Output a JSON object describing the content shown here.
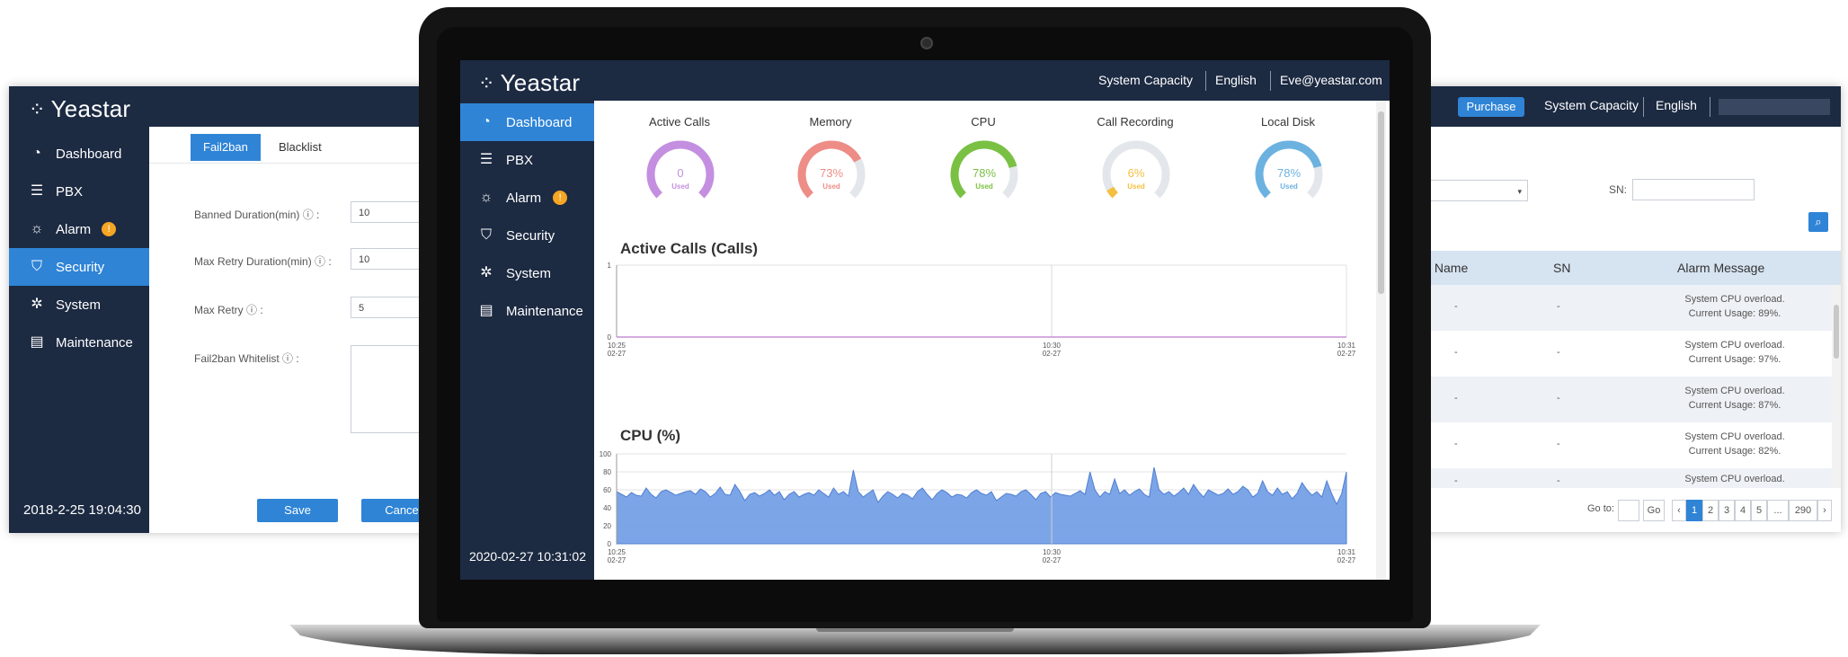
{
  "brand": {
    "name": "Yeastar"
  },
  "left_panel": {
    "sidebar": {
      "items": [
        {
          "label": "Dashboard",
          "icon": "dashboard-icon"
        },
        {
          "label": "PBX",
          "icon": "pbx-icon"
        },
        {
          "label": "Alarm",
          "icon": "alarm-icon",
          "badge": "!"
        },
        {
          "label": "Security",
          "icon": "shield-icon"
        },
        {
          "label": "System",
          "icon": "gear-icon"
        },
        {
          "label": "Maintenance",
          "icon": "maintenance-icon"
        }
      ],
      "active": "Security",
      "timestamp": "2018-2-25 19:04:30"
    },
    "tabs": [
      "Fail2ban",
      "Blacklist"
    ],
    "active_tab": "Fail2ban",
    "form": {
      "banned_duration": {
        "label": "Banned Duration(min) ⓘ :",
        "value": "10"
      },
      "max_retry_duration": {
        "label": "Max Retry Duration(min) ⓘ :",
        "value": "10"
      },
      "max_retry": {
        "label": "Max Retry ⓘ :",
        "value": "5"
      },
      "whitelist": {
        "label": "Fail2ban Whitelist ⓘ :",
        "value": ""
      }
    },
    "buttons": {
      "save": "Save",
      "cancel": "Cance"
    }
  },
  "right_panel": {
    "topbar": {
      "purchase": "Purchase",
      "capacity": "System Capacity",
      "language": "English"
    },
    "sn_label": "SN:",
    "table": {
      "columns": [
        "PBX Name",
        "SN",
        "Alarm Message"
      ],
      "rows": [
        {
          "pbx": "-",
          "sn": "-",
          "msg1": "System CPU overload.",
          "msg2": "Current Usage: 89%."
        },
        {
          "pbx": "-",
          "sn": "-",
          "msg1": "System CPU overload.",
          "msg2": "Current Usage: 97%."
        },
        {
          "pbx": "-",
          "sn": "-",
          "msg1": "System CPU overload.",
          "msg2": "Current Usage: 87%."
        },
        {
          "pbx": "-",
          "sn": "-",
          "msg1": "System CPU overload.",
          "msg2": "Current Usage: 82%."
        },
        {
          "pbx": "-",
          "sn": "-",
          "msg1": "System CPU overload.",
          "msg2": ""
        }
      ]
    },
    "pagination": {
      "goto_label": "Go to:",
      "go": "Go",
      "pages": [
        "1",
        "2",
        "3",
        "4",
        "5"
      ],
      "ellipsis": "...",
      "last": "290",
      "current": "1"
    }
  },
  "screen": {
    "topbar": {
      "capacity": "System Capacity",
      "language": "English",
      "user": "Eve@yeastar.com"
    },
    "sidebar": {
      "items": [
        {
          "label": "Dashboard",
          "icon": "dashboard-icon"
        },
        {
          "label": "PBX",
          "icon": "pbx-icon"
        },
        {
          "label": "Alarm",
          "icon": "alarm-icon",
          "badge": "!"
        },
        {
          "label": "Security",
          "icon": "shield-icon"
        },
        {
          "label": "System",
          "icon": "gear-icon"
        },
        {
          "label": "Maintenance",
          "icon": "maintenance-icon"
        }
      ],
      "active": "Dashboard",
      "timestamp": "2020-02-27 10:31:02"
    },
    "gauges": [
      {
        "label": "Active Calls",
        "value_text": "0",
        "sub": "Used",
        "percent": 0,
        "color": "#c48fe0"
      },
      {
        "label": "Memory",
        "value_text": "73%",
        "sub": "Used",
        "percent": 73,
        "color": "#ee8c86"
      },
      {
        "label": "CPU",
        "value_text": "78%",
        "sub": "Used",
        "percent": 78,
        "color": "#7ac143"
      },
      {
        "label": "Call Recording",
        "value_text": "6%",
        "sub": "Used",
        "percent": 6,
        "color": "#f4c041"
      },
      {
        "label": "Local Disk",
        "value_text": "78%",
        "sub": "Used",
        "percent": 78,
        "color": "#6cb2e0"
      }
    ],
    "gauge_track_color": "#e3e6ea",
    "active_calls_chart": {
      "title": "Active Calls (Calls)",
      "y_ticks": [
        "1",
        "0"
      ],
      "x_ticks": [
        {
          "t": "10:25",
          "d": "02-27"
        },
        {
          "t": "10:30",
          "d": "02-27"
        },
        {
          "t": "10:31",
          "d": "02-27"
        }
      ]
    },
    "cpu_chart": {
      "title": "CPU (%)",
      "y_ticks": [
        "100",
        "80",
        "60",
        "40",
        "20",
        "0"
      ],
      "x_ticks": [
        {
          "t": "10:25",
          "d": "02-27"
        },
        {
          "t": "10:30",
          "d": "02-27"
        },
        {
          "t": "10:31",
          "d": "02-27"
        }
      ],
      "series_color": "#6e9be6"
    }
  },
  "chart_data": [
    {
      "type": "line",
      "title": "Active Calls (Calls)",
      "x": [
        "10:25 02-27",
        "10:30 02-27",
        "10:31 02-27"
      ],
      "values": [
        0,
        0,
        0
      ],
      "ylim": [
        0,
        1
      ]
    },
    {
      "type": "area",
      "title": "CPU (%)",
      "ylim": [
        0,
        100
      ],
      "x_range": [
        "10:25 02-27",
        "10:31 02-27"
      ],
      "values": [
        58,
        55,
        52,
        57,
        54,
        53,
        62,
        55,
        51,
        58,
        60,
        57,
        54,
        56,
        58,
        59,
        55,
        61,
        58,
        52,
        56,
        63,
        55,
        54,
        66,
        58,
        48,
        55,
        57,
        53,
        56,
        60,
        54,
        58,
        49,
        55,
        58,
        52,
        55,
        57,
        54,
        60,
        56,
        52,
        62,
        55,
        58,
        53,
        82,
        58,
        52,
        56,
        60,
        46,
        53,
        58,
        55,
        51,
        56,
        54,
        50,
        58,
        62,
        55,
        49,
        56,
        60,
        57,
        52,
        55,
        54,
        51,
        57,
        60,
        56,
        54,
        58,
        48,
        52,
        56,
        55,
        53,
        58,
        60,
        55,
        49,
        56,
        58,
        52,
        57,
        55,
        54,
        53,
        56,
        59,
        55,
        80,
        60,
        52,
        58,
        55,
        72,
        56,
        60,
        54,
        58,
        61,
        55,
        52,
        85,
        60,
        55,
        58,
        53,
        57,
        62,
        55,
        66,
        58,
        52,
        60,
        57,
        54,
        56,
        61,
        55,
        58,
        64,
        60,
        52,
        56,
        70,
        58,
        54,
        62,
        55,
        58,
        50,
        56,
        68,
        60,
        54,
        58,
        52,
        70,
        56,
        44,
        55,
        80
      ]
    }
  ]
}
